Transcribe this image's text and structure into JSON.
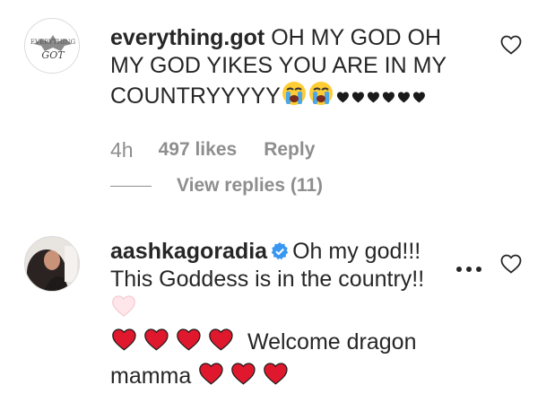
{
  "comment1": {
    "username": "everything.got",
    "text": "OH MY GOD OH MY GOD YIKES YOU ARE IN MY COUNTRYYYYY",
    "avatar_label": "GOT",
    "time": "4h",
    "likes": "497 likes",
    "reply_label": "Reply",
    "view_replies": "View replies (11)",
    "emojis": [
      "loudly-crying-face-emoji",
      "loudly-crying-face-emoji"
    ],
    "black_heart_count": 6
  },
  "comment2": {
    "username": "aashkagoradia",
    "text_part1": "Oh my god!!! This Goddess is in the country!!",
    "text_part2": "Welcome dragon mamma",
    "emojis_before_welcome": 4,
    "emojis_after_mamma": 3
  },
  "colors": {
    "text": "#262626",
    "secondary": "#8e8e8e",
    "verified": "#3897f0",
    "red_heart": "#e0182d",
    "pale_heart": "#ffe6ea"
  }
}
